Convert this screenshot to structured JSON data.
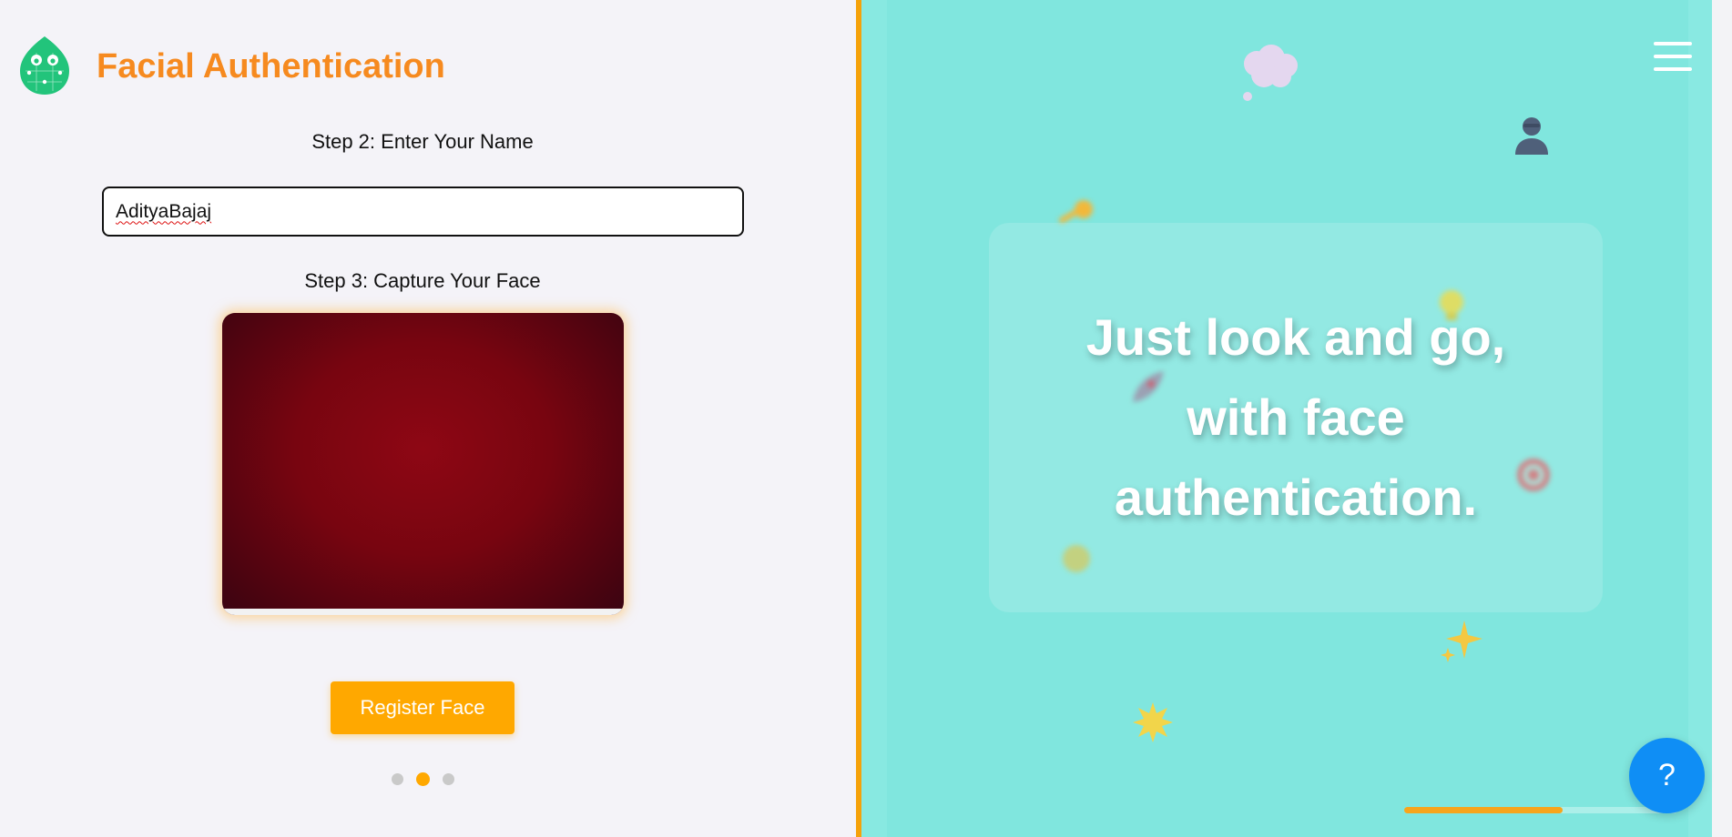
{
  "app": {
    "title": "Facial Authentication"
  },
  "steps": {
    "name_label": "Step 2: Enter Your Name",
    "name_value": "AdityaBajaj",
    "face_label": "Step 3: Capture Your Face"
  },
  "actions": {
    "register_label": "Register Face",
    "help_label": "?"
  },
  "pagination": {
    "total": 3,
    "active_index": 1
  },
  "hero": {
    "tagline": "Just look and go, with face authentication."
  },
  "progress": {
    "fraction": 0.58
  },
  "icons": {
    "logo": "face-scan-logo-icon",
    "menu": "hamburger-menu-icon",
    "floaters": [
      "thought-cloud-icon",
      "user-silhouette-icon",
      "key-icon",
      "lightbulb-icon",
      "rocket-icon",
      "target-icon",
      "sun-icon",
      "sparkle-icon",
      "star-burst-icon"
    ]
  },
  "colors": {
    "brand_orange": "#f68a1f",
    "accent_amber": "#ffa800",
    "panel_teal": "#80e6de",
    "help_blue": "#0f8ef5",
    "logo_green": "#22c47b"
  }
}
